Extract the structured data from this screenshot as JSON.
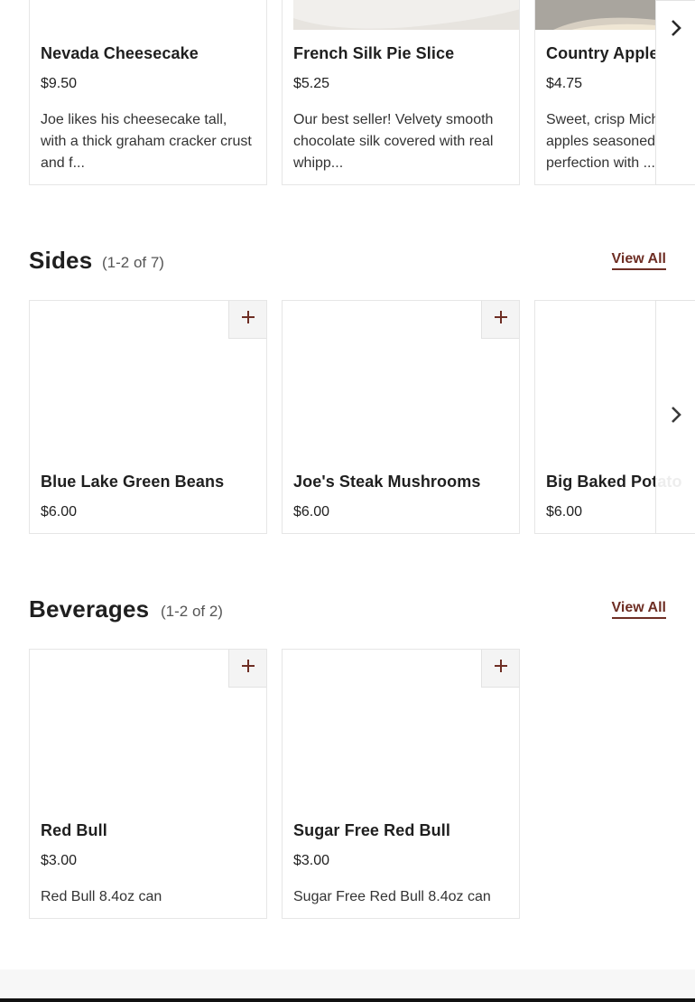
{
  "desserts": {
    "items": [
      {
        "name": "Nevada Cheesecake",
        "price": "$9.50",
        "desc": "Joe likes his cheesecake tall, with a thick graham cracker crust and f..."
      },
      {
        "name": "French Silk Pie Slice",
        "price": "$5.25",
        "desc": "Our best seller! Velvety smooth chocolate silk covered with real whipp..."
      },
      {
        "name": "Country Apple Pie Slice",
        "price": "$4.75",
        "desc": "Sweet, crisp Michigan Spy apples seasoned to perfection with ..."
      }
    ]
  },
  "sides": {
    "title": "Sides",
    "count": "(1-2 of 7)",
    "view_all": "View All",
    "items": [
      {
        "name": "Blue Lake Green Beans",
        "price": "$6.00"
      },
      {
        "name": "Joe's Steak Mushrooms",
        "price": "$6.00"
      },
      {
        "name": "Big Baked Potato",
        "price": "$6.00"
      }
    ]
  },
  "beverages": {
    "title": "Beverages",
    "count": "(1-2 of 2)",
    "view_all": "View All",
    "items": [
      {
        "name": "Red Bull",
        "price": "$3.00",
        "desc": "Red Bull 8.4oz can"
      },
      {
        "name": "Sugar Free Red Bull",
        "price": "$3.00",
        "desc": "Sugar Free Red Bull 8.4oz can"
      }
    ]
  },
  "icons": {
    "add": "plus-icon",
    "next": "chevron-right-icon"
  },
  "colors": {
    "accent": "#6e2e24",
    "card_border": "#e6e6e6",
    "button_bg": "#f4f4f4"
  }
}
